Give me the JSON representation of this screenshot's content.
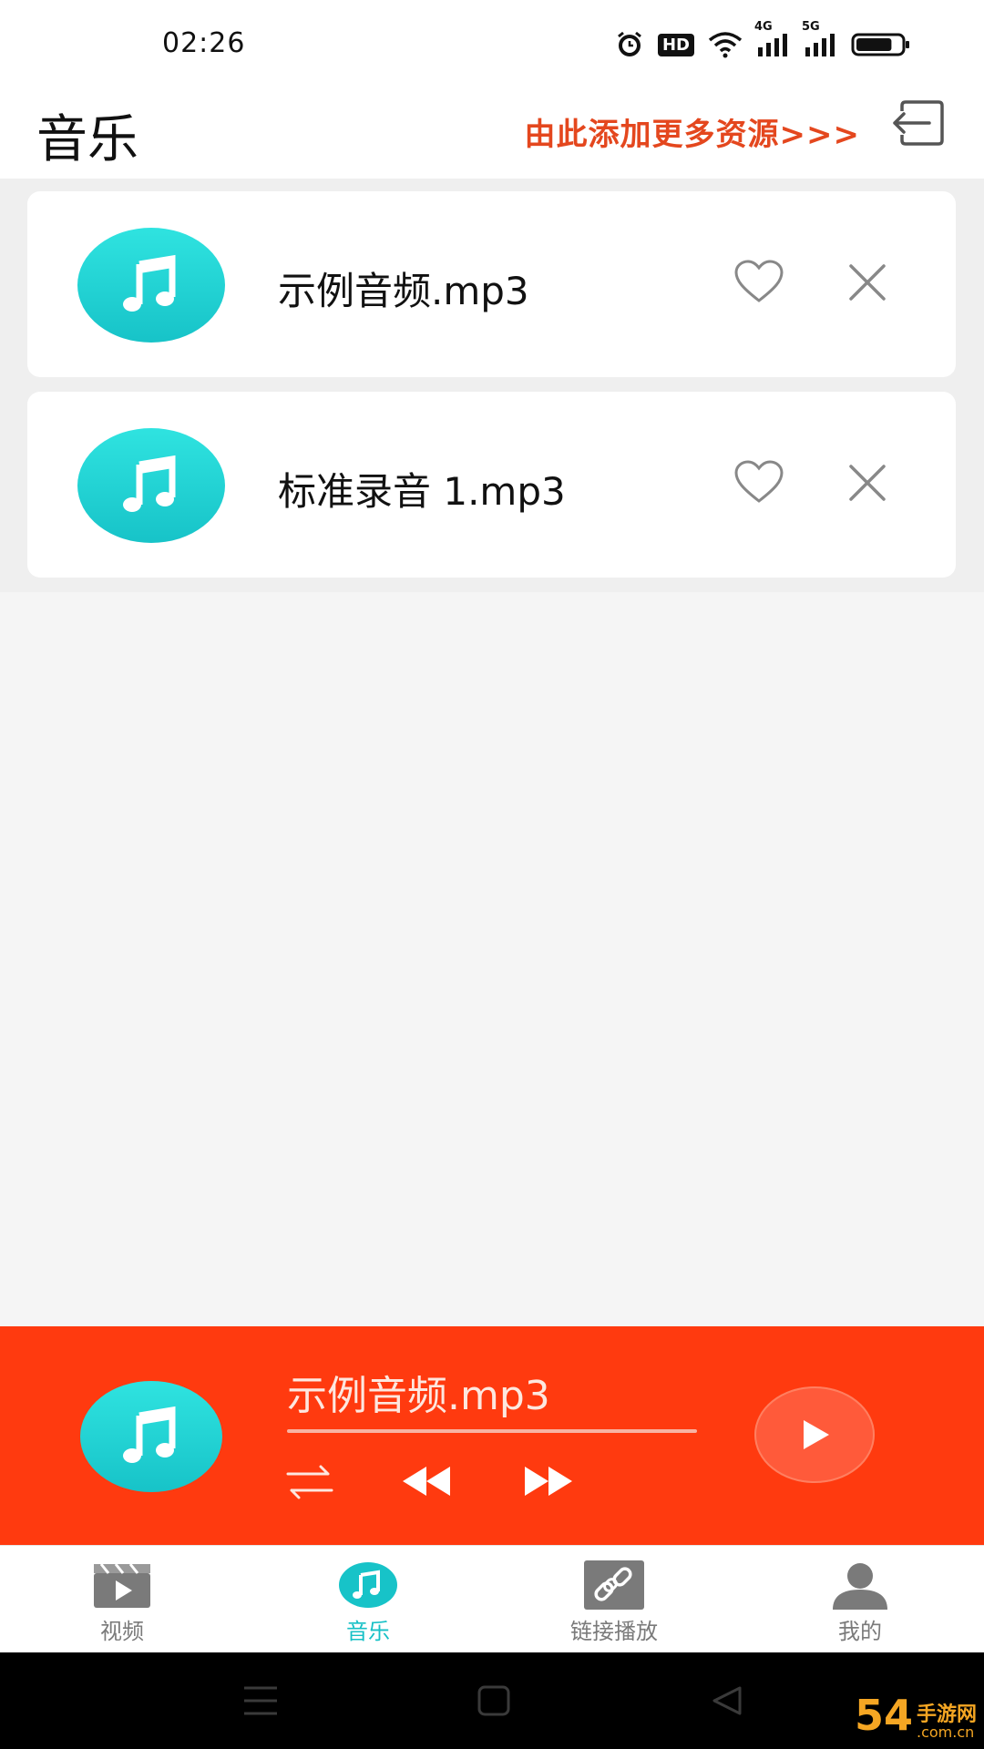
{
  "status_bar": {
    "time": "02:26",
    "icons": [
      "alarm-icon",
      "hd-icon",
      "wifi-icon",
      "signal-4g-icon",
      "signal-5g-icon",
      "battery-icon"
    ],
    "hd_label": "HD",
    "net_4g": "4G",
    "net_5g": "5G",
    "battery_level": 0.8
  },
  "header": {
    "title": "音乐",
    "add_link": "由此添加更多资源>>>"
  },
  "tracks": [
    {
      "title": "示例音频.mp3"
    },
    {
      "title": "标准录音 1.mp3"
    }
  ],
  "player": {
    "now_playing": "示例音频.mp3",
    "progress": 0.0
  },
  "bottom_nav": {
    "items": [
      {
        "label": "视频",
        "icon": "video-clapper-icon",
        "active": false
      },
      {
        "label": "音乐",
        "icon": "music-note-icon",
        "active": true
      },
      {
        "label": "链接播放",
        "icon": "link-icon",
        "active": false
      },
      {
        "label": "我的",
        "icon": "user-icon",
        "active": false
      }
    ]
  },
  "watermark": {
    "logo": "54",
    "site_name": "手游网",
    "domain": ".com.cn"
  },
  "colors": {
    "accent_cyan": "#17c3c8",
    "player_red": "#ff3a0f",
    "link_orange": "#e4471e"
  }
}
